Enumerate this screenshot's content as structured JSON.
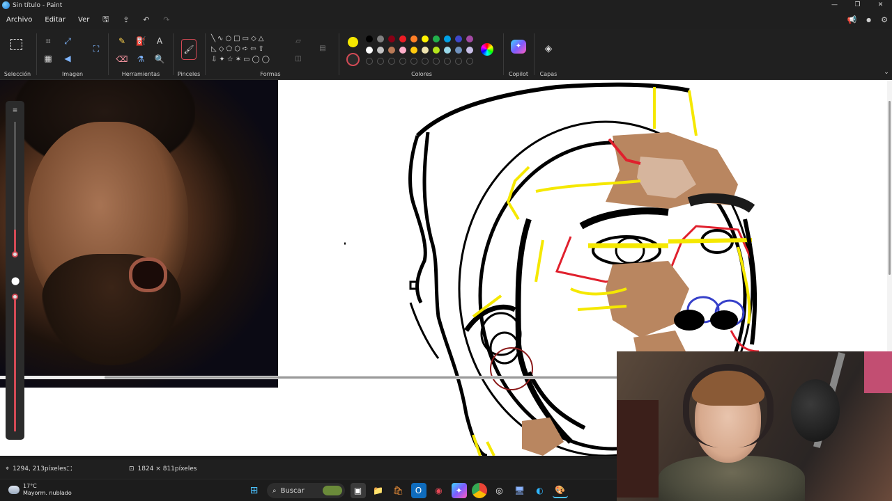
{
  "window": {
    "title": "Sin título - Paint",
    "controls": [
      "—",
      "❐",
      "✕"
    ]
  },
  "menu": {
    "items": [
      "Archivo",
      "Editar",
      "Ver"
    ]
  },
  "ribbon": {
    "groups": {
      "selection": "Selección",
      "image": "Imagen",
      "tools": "Herramientas",
      "brushes": "Pinceles",
      "shapes": "Formas",
      "colors": "Colores",
      "copilot": "Copilot",
      "layers": "Capas"
    },
    "colors": {
      "primary": "#f5e800",
      "secondary": "#ffffff",
      "row1": [
        "#000000",
        "#7f7f7f",
        "#880015",
        "#ed1c24",
        "#ff7f27",
        "#fff200",
        "#22b14c",
        "#00a2e8",
        "#3f48cc",
        "#a349a4"
      ],
      "row2": [
        "#ffffff",
        "#c3c3c3",
        "#b97a57",
        "#ffaec9",
        "#ffc90e",
        "#efe4b0",
        "#b5e61d",
        "#99d9ea",
        "#7092be",
        "#c8bfe7"
      ]
    }
  },
  "status": {
    "cursor_position": "1294, 213píxeles",
    "canvas_size": "1824 × 811píxeles"
  },
  "taskbar": {
    "weather_temp": "17°C",
    "weather_desc": "Mayorm. nublado",
    "search_label": "Buscar"
  }
}
